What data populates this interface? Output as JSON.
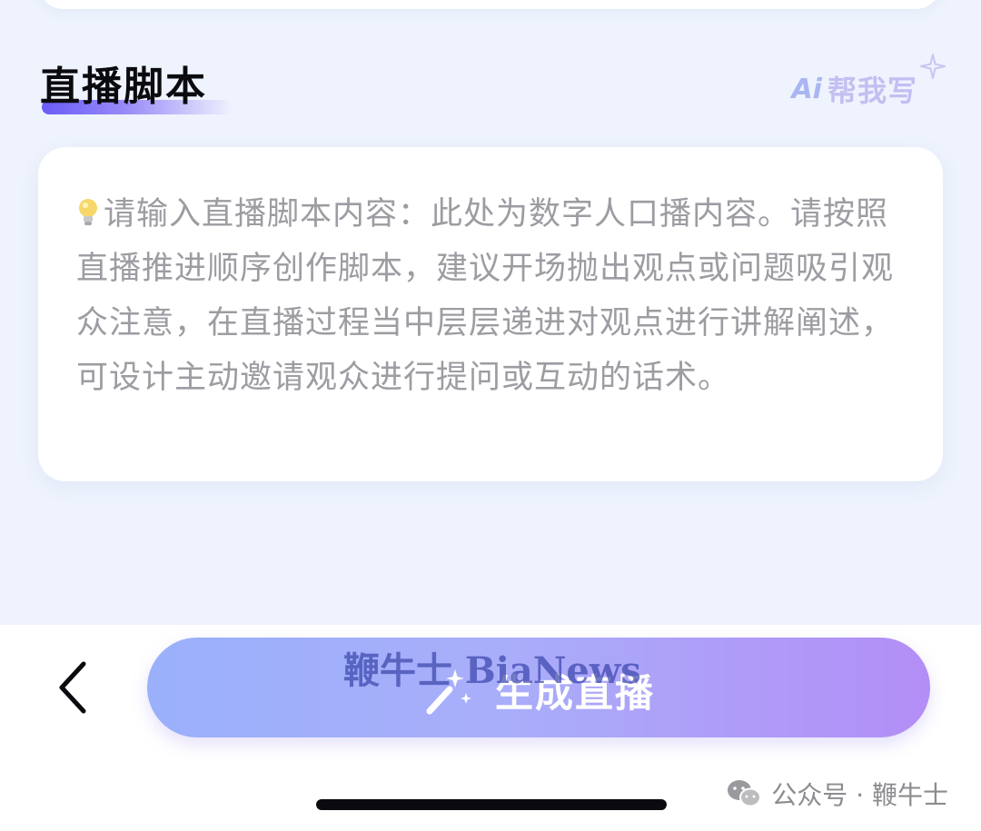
{
  "section": {
    "title": "直播脚本",
    "ai_help_logo": "Ai",
    "ai_help_label": "帮我写"
  },
  "script_input": {
    "placeholder": "请输入直播脚本内容：此处为数字人口播内容。请按照直播推进顺序创作脚本，建议开场抛出观点或问题吸引观众注意，在直播过程当中层层递进对观点进行讲解阐述，可设计主动邀请观众进行提问或互动的话术。",
    "placeholder_icon": "lightbulb-icon"
  },
  "bottom_bar": {
    "back_icon": "chevron-left-icon",
    "generate_label": "生成直播",
    "generate_icon": "magic-wand-icon"
  },
  "overlay": {
    "watermark": "鞭牛士 BiaNews",
    "wechat_source": "公众号 · 鞭牛士"
  },
  "colors": {
    "background": "#eef3fd",
    "button_gradient_start": "#9ab0fb",
    "button_gradient_end": "#b38ef6",
    "title_accent": "#6a5cf6",
    "placeholder_text": "#9c9ca2"
  }
}
